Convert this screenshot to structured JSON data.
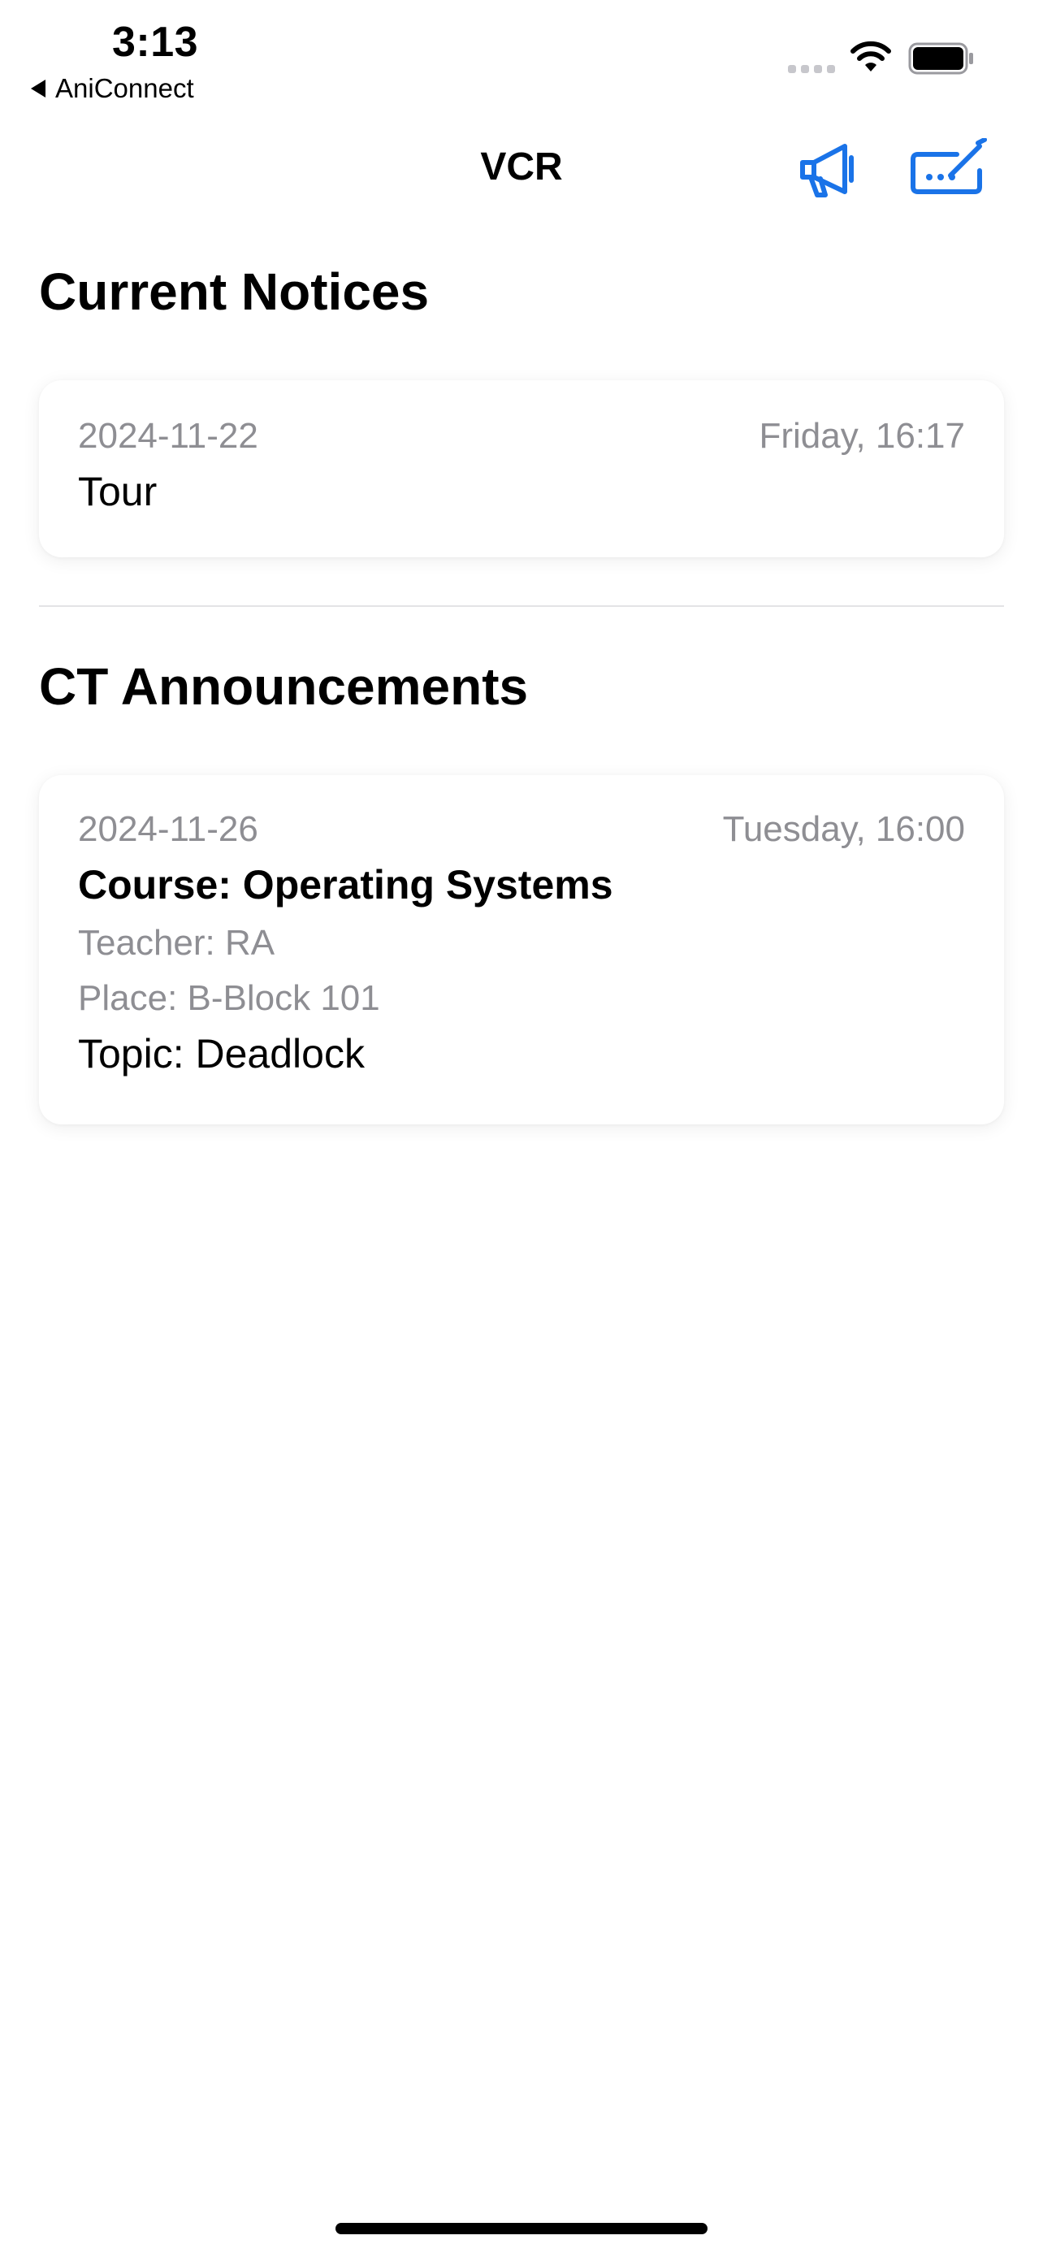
{
  "status_bar": {
    "time": "3:13",
    "back_app": "AniConnect",
    "icons": [
      "cellular-signal-icon",
      "wifi-icon",
      "battery-icon"
    ]
  },
  "nav": {
    "title": "VCR",
    "actions": [
      "megaphone-icon",
      "compose-keyboard-icon"
    ],
    "accent_color": "#1a73e8"
  },
  "sections": {
    "notices": {
      "title": "Current Notices",
      "items": [
        {
          "date": "2024-11-22",
          "day_time": "Friday, 16:17",
          "title": "Tour"
        }
      ]
    },
    "ct": {
      "title": "CT Announcements",
      "items": [
        {
          "date": "2024-11-26",
          "day_time": "Tuesday, 16:00",
          "course": "Course: Operating Systems",
          "teacher": "Teacher: RA",
          "place": "Place: B-Block 101",
          "topic": "Topic: Deadlock"
        }
      ]
    }
  },
  "colors": {
    "secondary_text": "#8e8e93",
    "divider": "#e3e3e6"
  }
}
